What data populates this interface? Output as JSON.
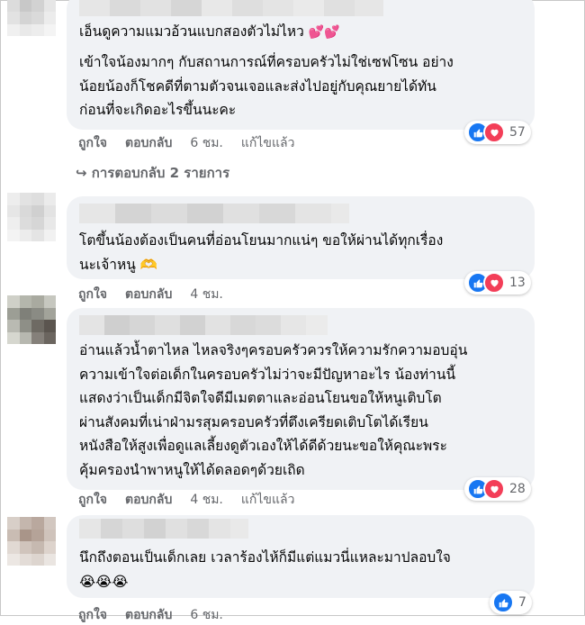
{
  "comments": [
    {
      "line1": "เอ็นดูความแมวอ้วนแบกสองตัวไม่ไหว",
      "emoji1": "💕",
      "paragraph": "เข้าใจน้องมากๆ กับสถานการณ์ที่ครอบครัวไม่ใช่เซฟโซน อย่าง\nน้อยน้องก็โชคดีที่ตามตัวจนเจอและส่งไปอยู่กับคุณยายได้ทัน\nก่อนที่จะเกิดอะไรขึ้นนะคะ",
      "like": "ถูกใจ",
      "reply": "ตอบกลับ",
      "time": "6 ชม.",
      "edited": "แก้ไขแล้ว",
      "reaction_count": "57",
      "replies_link": "↪ การตอบกลับ 2 รายการ"
    },
    {
      "text": "โตขึ้นน้องต้องเป็นคนที่อ่อนโยนมากแน่ๆ ขอให้ผ่านได้ทุกเรื่อง\nนะเจ้าหนู 🫶",
      "like": "ถูกใจ",
      "reply": "ตอบกลับ",
      "time": "4 ชม.",
      "reaction_count": "13"
    },
    {
      "text": "อ่านแล้วน้ำตาไหล ไหลจริงๆครอบครัวควรให้ความรักความอบอุ่น\nความเข้าใจต่อเด็กในครอบครัวไม่ว่าจะมีปัญหาอะไร น้องท่านนี้\nแสดงว่าเป็นเด็กมีจิตใจดีมีเมตตาและอ่อนโยนขอให้หนูเติบโต\nผ่านสังคมที่เน่าฝ่ามรสุมครอบครัวที่ตึงเครียดเติบโตได้เรียน\nหนังสือให้สูงเพื่อดูแลเลี้ยงดูตัวเองให้ได้ดีด้วยนะขอให้คุณะพระ\nคุ้มครองนำพาหนูให้ได้ดลอดๆด้วยเถิด",
      "like": "ถูกใจ",
      "reply": "ตอบกลับ",
      "time": "4 ชม.",
      "edited": "แก้ไขแล้ว",
      "reaction_count": "28"
    },
    {
      "text": "นึกถึงตอนเป็นเด็กเลย เวลาร้องไห้ก็มีแต่แมวนี่แหละมาปลอบใจ\n😭😭😭",
      "like": "ถูกใจ",
      "reply": "ตอบกลับ",
      "time": "6 ชม.",
      "reaction_count": "7"
    }
  ],
  "colors": {
    "bubble": "#f0f2f5",
    "meta": "#65676b",
    "like": "#1877f2",
    "love": "#f33e58"
  }
}
